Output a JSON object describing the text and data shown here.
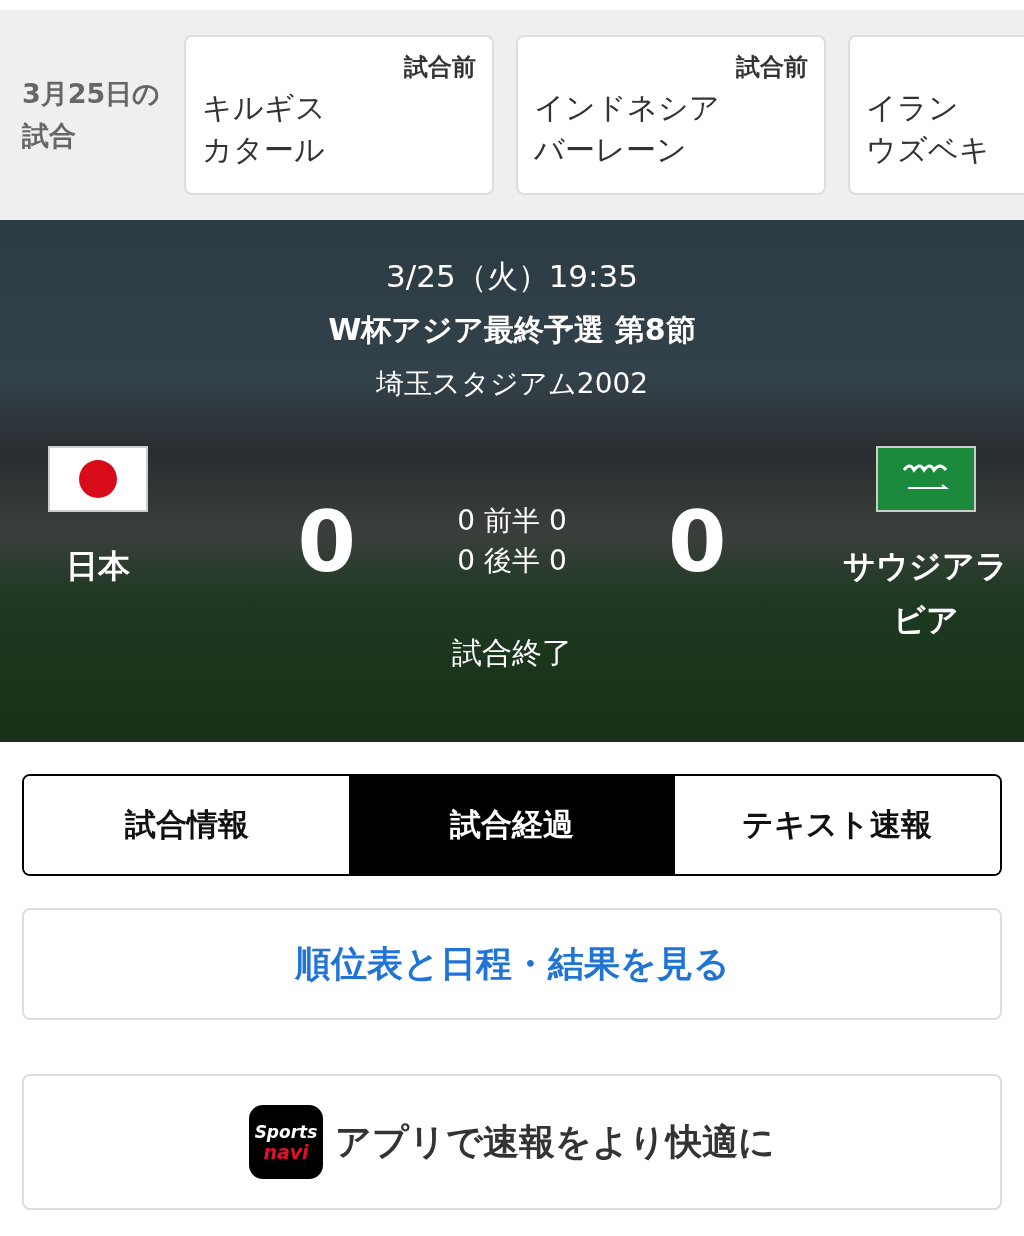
{
  "schedule": {
    "date_label": "3月25日の試合",
    "matches": [
      {
        "status": "試合前",
        "home": "キルギス",
        "away": "カタール"
      },
      {
        "status": "試合前",
        "home": "インドネシア",
        "away": "バーレーン"
      },
      {
        "home": "イラン",
        "away": "ウズベキ"
      }
    ]
  },
  "match": {
    "datetime": "3/25（火）19:35",
    "competition": "W杯アジア最終予選 第8節",
    "venue": "埼玉スタジアム2002",
    "teams": [
      {
        "kind": "japan",
        "name": "日本",
        "score": "0"
      },
      {
        "kind": "saudi",
        "name": "サウジアラビア",
        "score": "0"
      }
    ],
    "halves": [
      {
        "home": "0",
        "label": "前半",
        "away": "0"
      },
      {
        "home": "0",
        "label": "後半",
        "away": "0"
      }
    ],
    "status": "試合終了"
  },
  "tabs": [
    {
      "label": "試合情報",
      "selected": false
    },
    {
      "label": "試合経過",
      "selected": true
    },
    {
      "label": "テキスト速報",
      "selected": false
    }
  ],
  "standings_link": "順位表と日程・結果を見る",
  "app_banner": {
    "logo_top": "Sports",
    "logo_bottom": "navi",
    "text": "アプリで速報をより快適に"
  }
}
